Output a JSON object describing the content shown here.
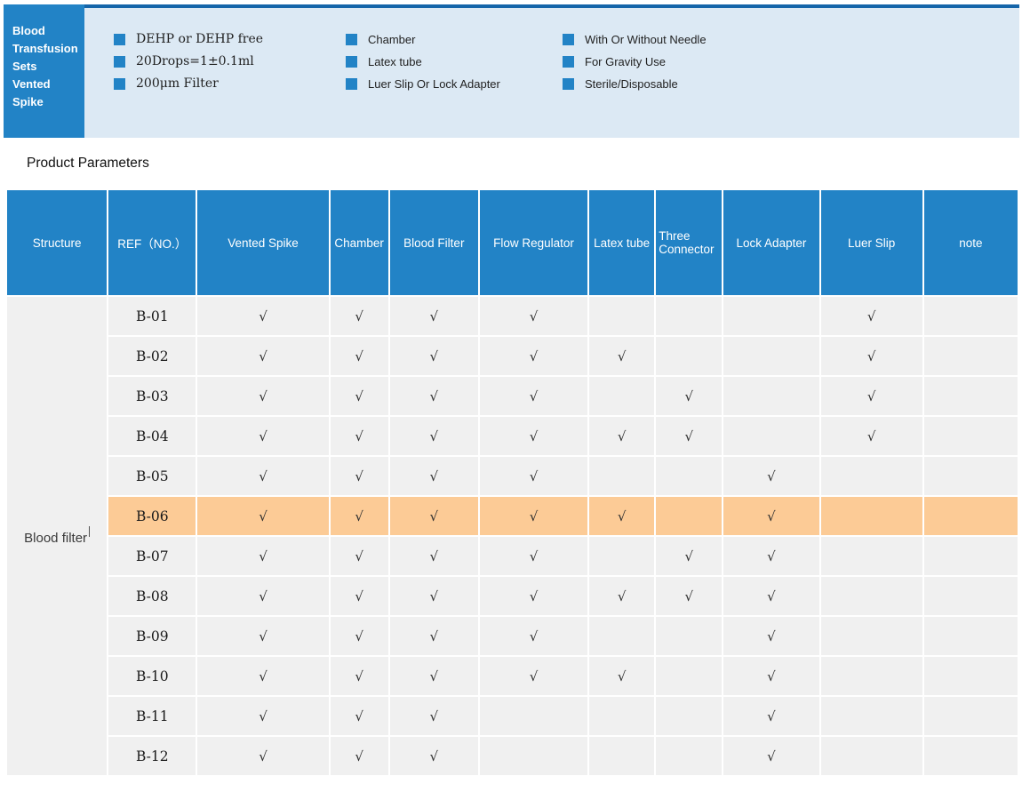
{
  "colors": {
    "primary_blue": "#2283C6",
    "banner_bg": "#DCE9F4",
    "banner_border": "#1565A9",
    "cell_bg": "#F0F0F0",
    "highlight": "#FCCB96",
    "check_color": "#2F2F2F"
  },
  "banner": {
    "title_lines": [
      "Blood",
      "Transfusion",
      "Sets",
      "Vented",
      "Spike"
    ],
    "feature_columns": [
      [
        "DEHP or DEHP free",
        "20Drops=1±0.1ml",
        "200μm Filter"
      ],
      [
        "Chamber",
        "Latex tube",
        "Luer Slip Or Lock Adapter"
      ],
      [
        "With Or Without Needle",
        "For Gravity Use",
        "Sterile/Disposable"
      ]
    ]
  },
  "section_title": "Product Parameters",
  "table": {
    "columns": [
      "Structure",
      "REF（NO.）",
      "Vented Spike",
      "Chamber",
      "Blood Filter",
      "Flow Regulator",
      "Latex tube",
      "Three Connector",
      "Lock Adapter",
      "Luer Slip",
      "note"
    ],
    "structure_label": "Blood filter",
    "check_mark": "√",
    "highlighted_ref": "B-06",
    "rows": [
      {
        "ref": "B-01",
        "checks": [
          1,
          1,
          1,
          1,
          0,
          0,
          0,
          1,
          0
        ]
      },
      {
        "ref": "B-02",
        "checks": [
          1,
          1,
          1,
          1,
          1,
          0,
          0,
          1,
          0
        ]
      },
      {
        "ref": "B-03",
        "checks": [
          1,
          1,
          1,
          1,
          0,
          1,
          0,
          1,
          0
        ]
      },
      {
        "ref": "B-04",
        "checks": [
          1,
          1,
          1,
          1,
          1,
          1,
          0,
          1,
          0
        ]
      },
      {
        "ref": "B-05",
        "checks": [
          1,
          1,
          1,
          1,
          0,
          0,
          1,
          0,
          0
        ]
      },
      {
        "ref": "B-06",
        "checks": [
          1,
          1,
          1,
          1,
          1,
          0,
          1,
          0,
          0
        ]
      },
      {
        "ref": "B-07",
        "checks": [
          1,
          1,
          1,
          1,
          0,
          1,
          1,
          0,
          0
        ]
      },
      {
        "ref": "B-08",
        "checks": [
          1,
          1,
          1,
          1,
          1,
          1,
          1,
          0,
          0
        ]
      },
      {
        "ref": "B-09",
        "checks": [
          1,
          1,
          1,
          1,
          0,
          0,
          1,
          0,
          0
        ]
      },
      {
        "ref": "B-10",
        "checks": [
          1,
          1,
          1,
          1,
          1,
          0,
          1,
          0,
          0
        ]
      },
      {
        "ref": "B-11",
        "checks": [
          1,
          1,
          1,
          0,
          0,
          0,
          1,
          0,
          0
        ]
      },
      {
        "ref": "B-12",
        "checks": [
          1,
          1,
          1,
          0,
          0,
          0,
          1,
          0,
          0
        ]
      }
    ]
  }
}
